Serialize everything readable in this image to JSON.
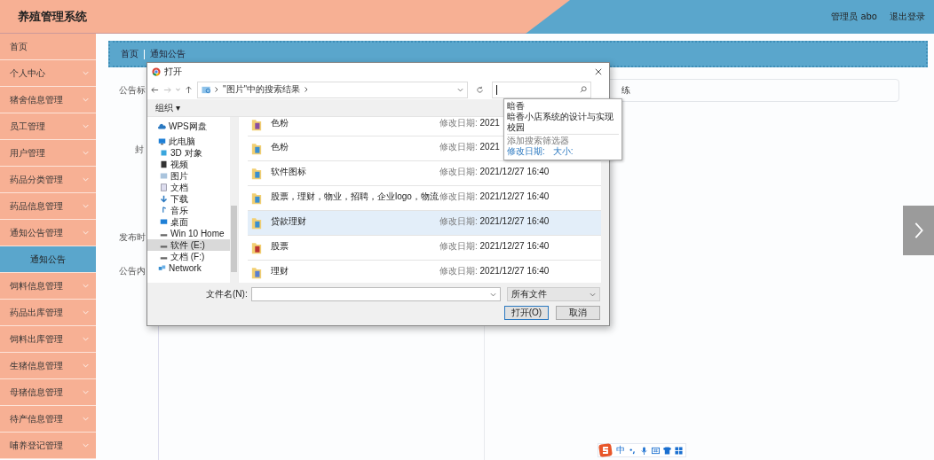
{
  "header": {
    "title": "养殖管理系统",
    "user": "管理员 abo",
    "logout": "退出登录"
  },
  "sidebar": {
    "items": [
      {
        "label": "首页",
        "kind": "link",
        "selected": false
      },
      {
        "label": "个人中心",
        "kind": "group",
        "selected": false
      },
      {
        "label": "猪舍信息管理",
        "kind": "group",
        "selected": false
      },
      {
        "label": "员工管理",
        "kind": "group",
        "selected": false
      },
      {
        "label": "用户管理",
        "kind": "group",
        "selected": false
      },
      {
        "label": "药品分类管理",
        "kind": "group",
        "selected": false
      },
      {
        "label": "药品信息管理",
        "kind": "group",
        "selected": false
      },
      {
        "label": "通知公告管理",
        "kind": "group",
        "selected": false
      },
      {
        "label": "通知公告",
        "kind": "sub",
        "selected": true
      },
      {
        "label": "饲料信息管理",
        "kind": "group",
        "selected": false
      },
      {
        "label": "药品出库管理",
        "kind": "group",
        "selected": false
      },
      {
        "label": "饲料出库管理",
        "kind": "group",
        "selected": false
      },
      {
        "label": "生猪信息管理",
        "kind": "group",
        "selected": false
      },
      {
        "label": "母猪信息管理",
        "kind": "group",
        "selected": false
      },
      {
        "label": "待产信息管理",
        "kind": "group",
        "selected": false
      },
      {
        "label": "哺养登记管理",
        "kind": "group",
        "selected": false
      }
    ]
  },
  "breadcrumb": [
    "首页",
    "通知公告"
  ],
  "form": {
    "labels": [
      "公告标",
      "封",
      "发布时",
      "公告内"
    ],
    "title_value": "练"
  },
  "dialog": {
    "title": "打开",
    "path": "\"图片\"中的搜索结果",
    "toolbar": "组织 ▾",
    "nav": [
      {
        "label": "WPS网盘",
        "selected": false
      },
      {
        "label": "此电脑",
        "selected": false,
        "children": [
          {
            "label": "3D 对象",
            "selected": false
          },
          {
            "label": "视频",
            "selected": false
          },
          {
            "label": "图片",
            "selected": false
          },
          {
            "label": "文档",
            "selected": false
          },
          {
            "label": "下载",
            "selected": false
          },
          {
            "label": "音乐",
            "selected": false
          },
          {
            "label": "桌面",
            "selected": false
          },
          {
            "label": "Win 10 Home",
            "selected": false
          },
          {
            "label": "软件 (E:)",
            "selected": true
          },
          {
            "label": "文档 (F:)",
            "selected": false
          }
        ]
      },
      {
        "label": "Network",
        "selected": false
      }
    ],
    "files": [
      {
        "name": "色粉",
        "date_label": "修改日期:",
        "date": "2021",
        "selected": false
      },
      {
        "name": "色粉",
        "date_label": "修改日期:",
        "date": "2021",
        "selected": false
      },
      {
        "name": "软件图标",
        "date_label": "修改日期:",
        "date": "2021/12/27 16:40",
        "selected": false
      },
      {
        "name": "股票，理财，物业，招聘，企业logo，物流",
        "date_label": "修改日期:",
        "date": "2021/12/27 16:40",
        "selected": false
      },
      {
        "name": "贷款理财",
        "date_label": "修改日期:",
        "date": "2021/12/27 16:40",
        "selected": true
      },
      {
        "name": "股票",
        "date_label": "修改日期:",
        "date": "2021/12/27 16:40",
        "selected": false
      },
      {
        "name": "理财",
        "date_label": "修改日期:",
        "date": "2021/12/27 16:40",
        "selected": false
      }
    ],
    "suggestions": [
      "暗香",
      "暗香小店系统的设计与实现",
      "校园"
    ],
    "filter_title": "添加搜索筛选器",
    "filters": [
      "修改日期:",
      "大小:"
    ],
    "filename_label": "文件名(N):",
    "filetype": "所有文件",
    "open": "打开(O)",
    "cancel": "取消"
  },
  "ime": {
    "label": "中"
  }
}
